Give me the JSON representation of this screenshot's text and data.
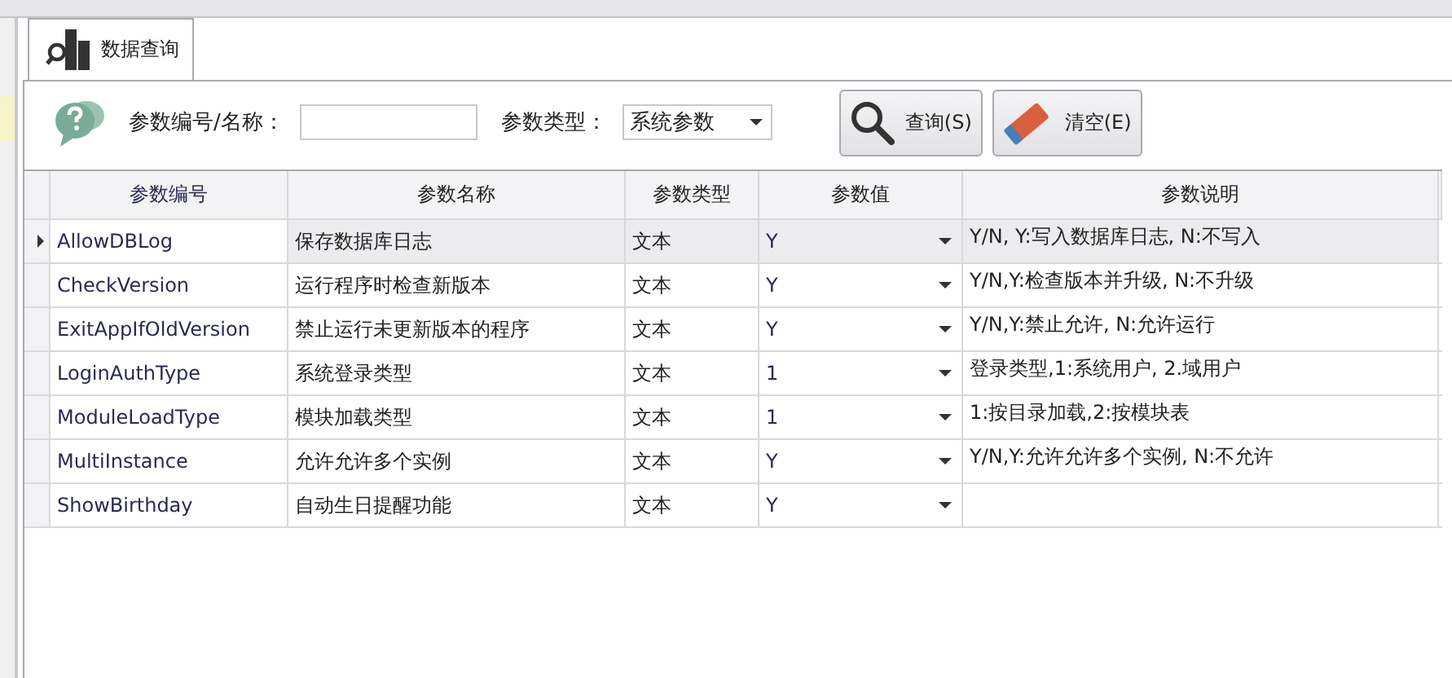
{
  "tabs": [
    {
      "label": "数据查询",
      "selected": true
    }
  ],
  "filters": {
    "code_label": "参数编号/名称：",
    "type_label": "参数类型：",
    "type_value": "系统参数"
  },
  "buttons": [
    {
      "kind": "search",
      "label": "查询(S)"
    },
    {
      "kind": "clear",
      "label": "清空(E)"
    }
  ],
  "table": {
    "columns": [
      "参数编号",
      "参数名称",
      "参数类型",
      "参数值",
      "参数说明"
    ],
    "rows": [
      {
        "selected": true,
        "code": "AllowDBLog",
        "name": "保存数据库日志",
        "type": "文本",
        "value": "Y",
        "description": "Y/N, Y:写入数据库日志, N:不写入"
      },
      {
        "selected": false,
        "code": "CheckVersion",
        "name": "运行程序时检查新版本",
        "type": "文本",
        "value": "Y",
        "description": "Y/N,Y:检查版本并升级, N:不升级"
      },
      {
        "selected": false,
        "code": "ExitAppIfOldVersion",
        "name": "禁止运行未更新版本的程序",
        "type": "文本",
        "value": "Y",
        "description": "Y/N,Y:禁止允许, N:允许运行"
      },
      {
        "selected": false,
        "code": "LoginAuthType",
        "name": "系统登录类型",
        "type": "文本",
        "value": "1",
        "description": "登录类型,1:系统用户, 2.域用户"
      },
      {
        "selected": false,
        "code": "ModuleLoadType",
        "name": "模块加载类型",
        "type": "文本",
        "value": "1",
        "description": "1:按目录加载,2:按模块表"
      },
      {
        "selected": false,
        "code": "MultiInstance",
        "name": "允许允许多个实例",
        "type": "文本",
        "value": "Y",
        "description": "Y/N,Y:允许允许多个实例, N:不允许"
      },
      {
        "selected": false,
        "code": "ShowBirthday",
        "name": "自动生日提醒功能",
        "type": "文本",
        "value": "Y"
      }
    ]
  }
}
